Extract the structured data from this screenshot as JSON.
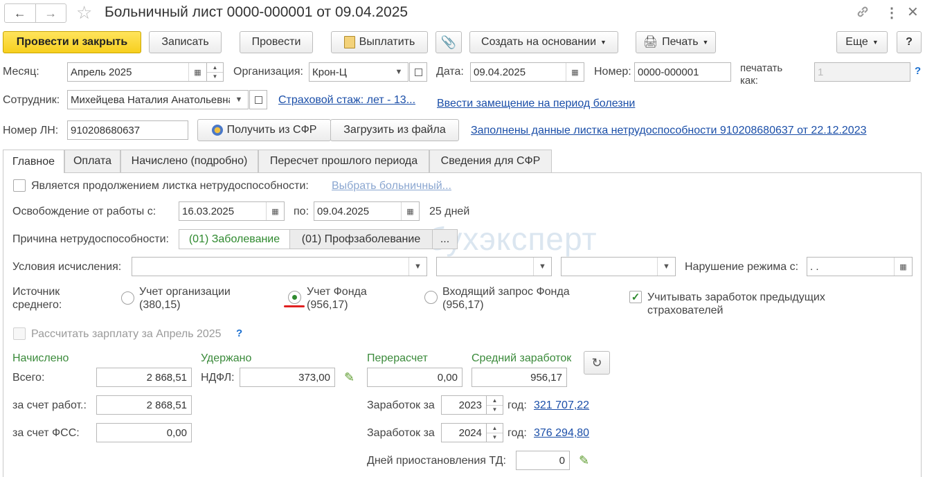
{
  "window": {
    "title": "Больничный лист 0000-000001 от 09.04.2025"
  },
  "toolbar": {
    "post_close": "Провести и закрыть",
    "save": "Записать",
    "post": "Провести",
    "pay": "Выплатить",
    "create_based": "Создать на основании",
    "print": "Печать",
    "more": "Еще",
    "help": "?"
  },
  "header": {
    "month_label": "Месяц:",
    "month_value": "Апрель 2025",
    "org_label": "Организация:",
    "org_value": "Крон-Ц",
    "date_label": "Дата:",
    "date_value": "09.04.2025",
    "number_label": "Номер:",
    "number_value": "0000-000001",
    "print_as_label_1": "печатать",
    "print_as_label_2": "как:",
    "print_as_value": "1",
    "print_as_help": "?",
    "employee_label": "Сотрудник:",
    "employee_value": "Михейцева Наталия Анатольевна",
    "insurance_link": "Страховой стаж: лет - 13...",
    "substitution_link": "Ввести замещение на период болезни",
    "ln_label": "Номер ЛН:",
    "ln_value": "910208680637",
    "get_sfr": "Получить из СФР",
    "load_file": "Загрузить из файла",
    "ln_filled_link": "Заполнены данные листка нетрудоспособности 910208680637 от 22.12.2023"
  },
  "tabs": [
    "Главное",
    "Оплата",
    "Начислено (подробно)",
    "Пересчет прошлого периода",
    "Сведения для СФР"
  ],
  "main": {
    "continuation_label": "Является продолжением листка нетрудоспособности:",
    "choose_sick_link": "Выбрать больничный...",
    "release_label": "Освобождение от работы с:",
    "release_from": "16.03.2025",
    "release_to_label": "по:",
    "release_to": "09.04.2025",
    "days": "25 дней",
    "reason_label": "Причина нетрудоспособности:",
    "reason_1": "(01) Заболевание",
    "reason_2": "(01) Профзаболевание",
    "reason_more": "...",
    "watermark": "бухэксперт",
    "conditions_label": "Условия исчисления:",
    "violation_label": "Нарушение режима с:",
    "violation_value": " .  .",
    "source_label_1": "Источник",
    "source_label_2": "среднего:",
    "radio_org": "Учет организации",
    "radio_org_val": "(380,15)",
    "radio_fund": "Учет Фонда",
    "radio_fund_val": "(956,17)",
    "radio_request": "Входящий запрос Фонда",
    "radio_request_val": "(956,17)",
    "prev_insurers_1": "Учитывать заработок предыдущих",
    "prev_insurers_2": "страхователей",
    "calc_salary_label": "Рассчитать зарплату за Апрель 2025",
    "calc_salary_help": "?",
    "accrued_title": "Начислено",
    "total_label": "Всего:",
    "total_value": "2 868,51",
    "employer_label": "за счет работ.:",
    "employer_value": "2 868,51",
    "fss_label": "за счет ФСС:",
    "fss_value": "0,00",
    "withheld_title": "Удержано",
    "ndfl_label": "НДФЛ:",
    "ndfl_value": "373,00",
    "recalc_title": "Перерасчет",
    "recalc_value": "0,00",
    "avg_title": "Средний заработок",
    "avg_value": "956,17",
    "earn_label": "Заработок за",
    "year1": "2023",
    "year_label": "год:",
    "earn1_link": "321 707,22",
    "year2": "2024",
    "earn2_link": "376 294,80",
    "suspension_label": "Дней приостановления ТД:",
    "suspension_value": "0"
  }
}
